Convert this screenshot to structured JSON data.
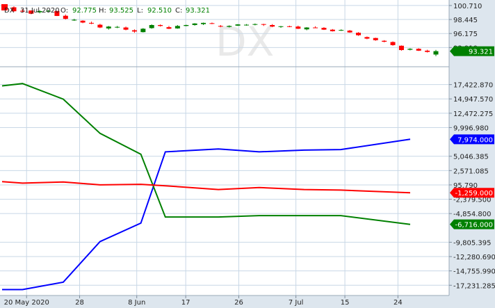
{
  "header": {
    "symbol": "DX",
    "date": "31 Jul 2020",
    "open_label": "O:",
    "open": "92.775",
    "high_label": "H:",
    "high": "93.525",
    "low_label": "L:",
    "low": "92.510",
    "close_label": "C:",
    "close": "93.321",
    "watermark": "DX"
  },
  "colors": {
    "up": "#008000",
    "down": "#ff0000",
    "blue_series": "#0000ff",
    "green_series": "#008000",
    "red_series": "#ff0000",
    "grid": "#c8d7e6",
    "frame": "#dde6ee"
  },
  "chart_data": [
    {
      "type": "candlestick",
      "title": "DX",
      "ylim": [
        90.8,
        101.6
      ],
      "y_ticks": [
        "100.710",
        "98.445",
        "96.175",
        "93.910"
      ],
      "last_value": "93.321",
      "candles": [
        {
          "o": 100.42,
          "h": 100.58,
          "l": 99.72,
          "c": 99.78
        },
        {
          "o": 99.85,
          "h": 100.12,
          "l": 99.58,
          "c": 99.75
        },
        {
          "o": 99.9,
          "h": 99.92,
          "l": 99.3,
          "c": 99.38
        },
        {
          "o": 99.62,
          "h": 99.95,
          "l": 99.45,
          "c": 99.8
        },
        {
          "o": 99.85,
          "h": 100.0,
          "l": 99.7,
          "c": 99.85
        },
        {
          "o": 99.82,
          "h": 99.85,
          "l": 99.0,
          "c": 99.02
        },
        {
          "o": 99.05,
          "h": 99.25,
          "l": 98.45,
          "c": 98.55
        },
        {
          "o": 98.4,
          "h": 98.55,
          "l": 98.22,
          "c": 98.4
        },
        {
          "o": 98.25,
          "h": 98.32,
          "l": 97.85,
          "c": 97.95
        },
        {
          "o": 97.9,
          "h": 98.1,
          "l": 97.7,
          "c": 97.78
        },
        {
          "o": 97.6,
          "h": 97.75,
          "l": 97.05,
          "c": 97.15
        },
        {
          "o": 97.0,
          "h": 97.4,
          "l": 96.8,
          "c": 97.3
        },
        {
          "o": 97.25,
          "h": 97.4,
          "l": 97.05,
          "c": 97.25
        },
        {
          "o": 97.15,
          "h": 97.3,
          "l": 96.7,
          "c": 96.8
        },
        {
          "o": 96.7,
          "h": 96.85,
          "l": 96.3,
          "c": 96.5
        },
        {
          "o": 96.4,
          "h": 97.05,
          "l": 96.35,
          "c": 96.95
        },
        {
          "o": 97.05,
          "h": 97.65,
          "l": 96.95,
          "c": 97.55
        },
        {
          "o": 97.55,
          "h": 97.65,
          "l": 97.3,
          "c": 97.4
        },
        {
          "o": 97.2,
          "h": 97.4,
          "l": 96.9,
          "c": 96.95
        },
        {
          "o": 97.0,
          "h": 97.55,
          "l": 96.95,
          "c": 97.4
        },
        {
          "o": 97.4,
          "h": 97.6,
          "l": 97.35,
          "c": 97.55
        },
        {
          "o": 97.55,
          "h": 97.85,
          "l": 97.45,
          "c": 97.8
        },
        {
          "o": 97.7,
          "h": 97.95,
          "l": 97.55,
          "c": 97.9
        },
        {
          "o": 97.85,
          "h": 97.95,
          "l": 97.7,
          "c": 97.75
        },
        {
          "o": 97.4,
          "h": 97.55,
          "l": 97.2,
          "c": 97.3
        },
        {
          "o": 97.25,
          "h": 97.5,
          "l": 97.15,
          "c": 97.4
        },
        {
          "o": 97.45,
          "h": 97.7,
          "l": 97.4,
          "c": 97.65
        },
        {
          "o": 97.55,
          "h": 97.7,
          "l": 97.45,
          "c": 97.6
        },
        {
          "o": 97.65,
          "h": 97.8,
          "l": 97.5,
          "c": 97.7
        },
        {
          "o": 97.7,
          "h": 97.75,
          "l": 97.4,
          "c": 97.6
        },
        {
          "o": 97.55,
          "h": 97.7,
          "l": 97.2,
          "c": 97.3
        },
        {
          "o": 97.3,
          "h": 97.4,
          "l": 97.1,
          "c": 97.35
        },
        {
          "o": 97.35,
          "h": 97.45,
          "l": 97.2,
          "c": 97.3
        },
        {
          "o": 97.3,
          "h": 97.45,
          "l": 96.9,
          "c": 96.95
        },
        {
          "o": 96.85,
          "h": 97.2,
          "l": 96.7,
          "c": 97.15
        },
        {
          "o": 97.15,
          "h": 97.35,
          "l": 97.05,
          "c": 97.1
        },
        {
          "o": 97.1,
          "h": 97.2,
          "l": 96.75,
          "c": 96.8
        },
        {
          "o": 96.8,
          "h": 96.9,
          "l": 96.5,
          "c": 96.55
        },
        {
          "o": 96.7,
          "h": 96.85,
          "l": 96.6,
          "c": 96.75
        },
        {
          "o": 96.65,
          "h": 96.75,
          "l": 96.3,
          "c": 96.35
        },
        {
          "o": 96.3,
          "h": 96.4,
          "l": 95.8,
          "c": 95.9
        },
        {
          "o": 95.6,
          "h": 95.7,
          "l": 95.25,
          "c": 95.35
        },
        {
          "o": 95.45,
          "h": 95.5,
          "l": 95.0,
          "c": 95.1
        },
        {
          "o": 95.0,
          "h": 95.1,
          "l": 94.75,
          "c": 94.85
        },
        {
          "o": 94.8,
          "h": 94.9,
          "l": 94.2,
          "c": 94.3
        },
        {
          "o": 94.2,
          "h": 94.25,
          "l": 93.4,
          "c": 93.5
        },
        {
          "o": 93.55,
          "h": 93.8,
          "l": 93.45,
          "c": 93.7
        },
        {
          "o": 93.7,
          "h": 93.8,
          "l": 93.35,
          "c": 93.4
        },
        {
          "o": 93.4,
          "h": 93.55,
          "l": 93.1,
          "c": 93.2
        },
        {
          "o": 92.775,
          "h": 93.525,
          "l": 92.51,
          "c": 93.321
        }
      ]
    },
    {
      "type": "line",
      "ylim": [
        -19000,
        20500
      ],
      "y_ticks": [
        "17,422.870",
        "14,947.570",
        "12,472.275",
        "9,996.980",
        "5,046.385",
        "2,571.085",
        "95.790",
        "-2,379.500",
        "-4,854.800",
        "-9,805.395",
        "-12,280.690",
        "-14,755.990",
        "-17,231.285"
      ],
      "x_tick_labels": [
        "20 May 2020",
        "28",
        "8 Jun",
        "17",
        "26",
        "7 Jul",
        "15",
        "24"
      ],
      "series": [
        {
          "color": "blue",
          "last_value": "7,974.000",
          "points": [
            [
              0,
              -17980
            ],
            [
              5,
              -17980
            ],
            [
              15,
              -16700
            ],
            [
              24,
              -9700
            ],
            [
              34,
              -6500
            ],
            [
              40,
              5800
            ],
            [
              53,
              6300
            ],
            [
              63,
              5800
            ],
            [
              74,
              6100
            ],
            [
              83,
              6200
            ],
            [
              100,
              7974
            ]
          ]
        },
        {
          "color": "green",
          "last_value": "-6,716.000",
          "points": [
            [
              0,
              17200
            ],
            [
              5,
              17600
            ],
            [
              15,
              14900
            ],
            [
              24,
              9000
            ],
            [
              34,
              5400
            ],
            [
              40,
              -5450
            ],
            [
              53,
              -5450
            ],
            [
              63,
              -5200
            ],
            [
              74,
              -5200
            ],
            [
              83,
              -5200
            ],
            [
              100,
              -6716
            ]
          ]
        },
        {
          "color": "red",
          "last_value": "-1,259.000",
          "points": [
            [
              0,
              650
            ],
            [
              5,
              400
            ],
            [
              15,
              600
            ],
            [
              24,
              100
            ],
            [
              34,
              200
            ],
            [
              40,
              -50
            ],
            [
              53,
              -700
            ],
            [
              63,
              -350
            ],
            [
              74,
              -700
            ],
            [
              83,
              -800
            ],
            [
              100,
              -1259
            ]
          ]
        }
      ]
    }
  ]
}
